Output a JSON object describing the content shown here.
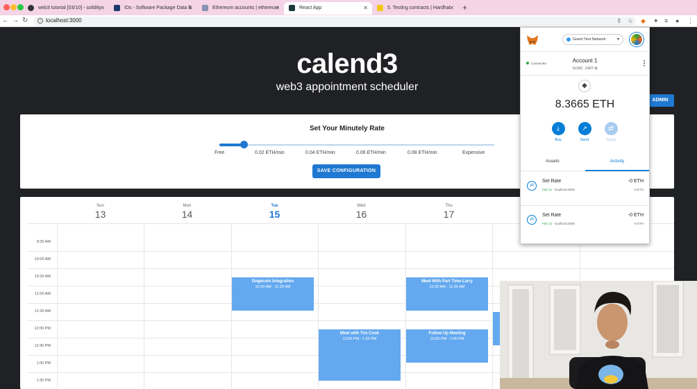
{
  "browser": {
    "tabs": [
      {
        "label": "web3 tutorial [03/10] - solidity",
        "icon_color": "#333333"
      },
      {
        "label": "IDs - Software Package Data E",
        "icon_color": "#1a3a6b"
      },
      {
        "label": "Ethereum accounts | ethereum",
        "icon_color": "#8a92b2"
      },
      {
        "label": "React App",
        "icon_color": "#1e3a3a"
      },
      {
        "label": "5. Testing contracts | Hardhat",
        "icon_color": "#f5c518"
      }
    ],
    "active_tab_index": 3,
    "url": "localhost:3000"
  },
  "app": {
    "title": "calend3",
    "subtitle": "web3 appointment scheduler",
    "admin_label": "ADMIN"
  },
  "rate": {
    "heading": "Set Your Minutely Rate",
    "marks": [
      "Free",
      "0.02 ETH/min",
      "0.04 ETH/min",
      "0.06 ETH/min",
      "0.08 ETH/min",
      "Expensive"
    ],
    "slider_fraction": 0.09,
    "save_label": "SAVE CONFIGURATION"
  },
  "calendar": {
    "days": [
      {
        "name": "Sun",
        "num": "13"
      },
      {
        "name": "Mon",
        "num": "14"
      },
      {
        "name": "Tue",
        "num": "15"
      },
      {
        "name": "Wed",
        "num": "16"
      },
      {
        "name": "Thu",
        "num": "17"
      }
    ],
    "today_index": 2,
    "times": [
      "9:30 AM",
      "10:00 AM",
      "10:30 AM",
      "11:00 AM",
      "11:30 AM",
      "12:00 PM",
      "12:30 PM",
      "1:00 PM",
      "1:30 PM"
    ],
    "appointments": [
      {
        "title": "Dogecoin Integration",
        "time": "10:30 AM - 11:30 AM"
      },
      {
        "title": "Meet With Part Time Larry",
        "time": "10:30 AM - 11:30 AM"
      },
      {
        "title": "Meet with Tim Cook",
        "time": "12:00 PM - 1:30 PM"
      },
      {
        "title": "Follow Up Meeting",
        "time": "12:00 PM - 1:00 PM"
      }
    ]
  },
  "metamask": {
    "network": "Goerli Test Network",
    "connected_label": "Connected",
    "account_name": "Account 1",
    "address": "0x39D...F6FF",
    "balance": "8.3665 ETH",
    "actions": [
      {
        "label": "Buy",
        "icon": "download-icon"
      },
      {
        "label": "Send",
        "icon": "arrow-up-right-icon"
      },
      {
        "label": "Swap",
        "icon": "swap-icon"
      }
    ],
    "tabs": [
      "Assets",
      "Activity"
    ],
    "active_tab": "Activity",
    "activity": [
      {
        "name": "Set Rate",
        "date": "Feb 14",
        "origin": "localhost:3000",
        "amount": "-0 ETH",
        "amount_sub": "-0 ETH"
      },
      {
        "name": "Set Rate",
        "date": "Feb 14",
        "origin": "localhost:3000",
        "amount": "-0 ETH",
        "amount_sub": "-0 ETH"
      }
    ]
  },
  "colors": {
    "accent": "#1f78d1",
    "appointment": "#64a9ef",
    "hero_bg": "#202124",
    "tab_strip": "#f4d4e6",
    "metamask_blue": "#037dd6"
  }
}
